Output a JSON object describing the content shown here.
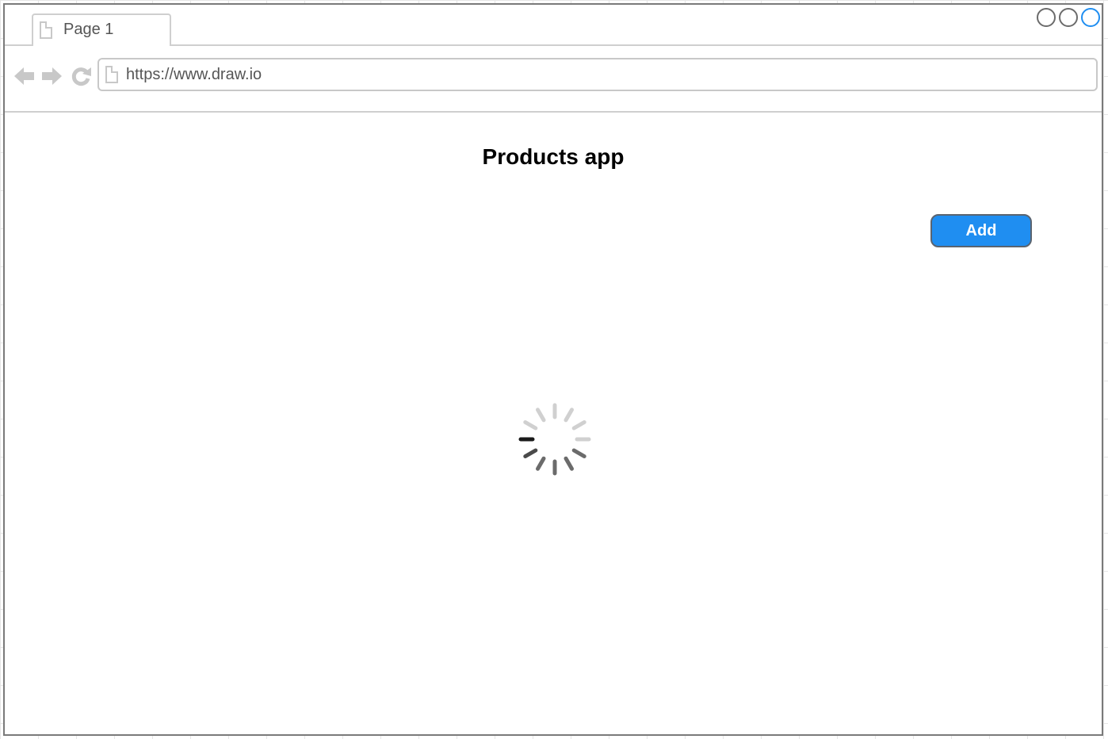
{
  "browser": {
    "tab_label": "Page 1",
    "url": "https://www.draw.io"
  },
  "page": {
    "title": "Products app",
    "add_button_label": "Add",
    "loading": true
  },
  "icons": {
    "back": "arrow-left-icon",
    "forward": "arrow-right-icon",
    "reload": "reload-icon",
    "page": "page-icon",
    "spinner": "loading-spinner-icon"
  },
  "colors": {
    "accent": "#1f8ef1",
    "chrome_border": "#7a7a7a",
    "chrome_divider": "#cfcfcf",
    "icon_gray": "#c8c8c8"
  }
}
